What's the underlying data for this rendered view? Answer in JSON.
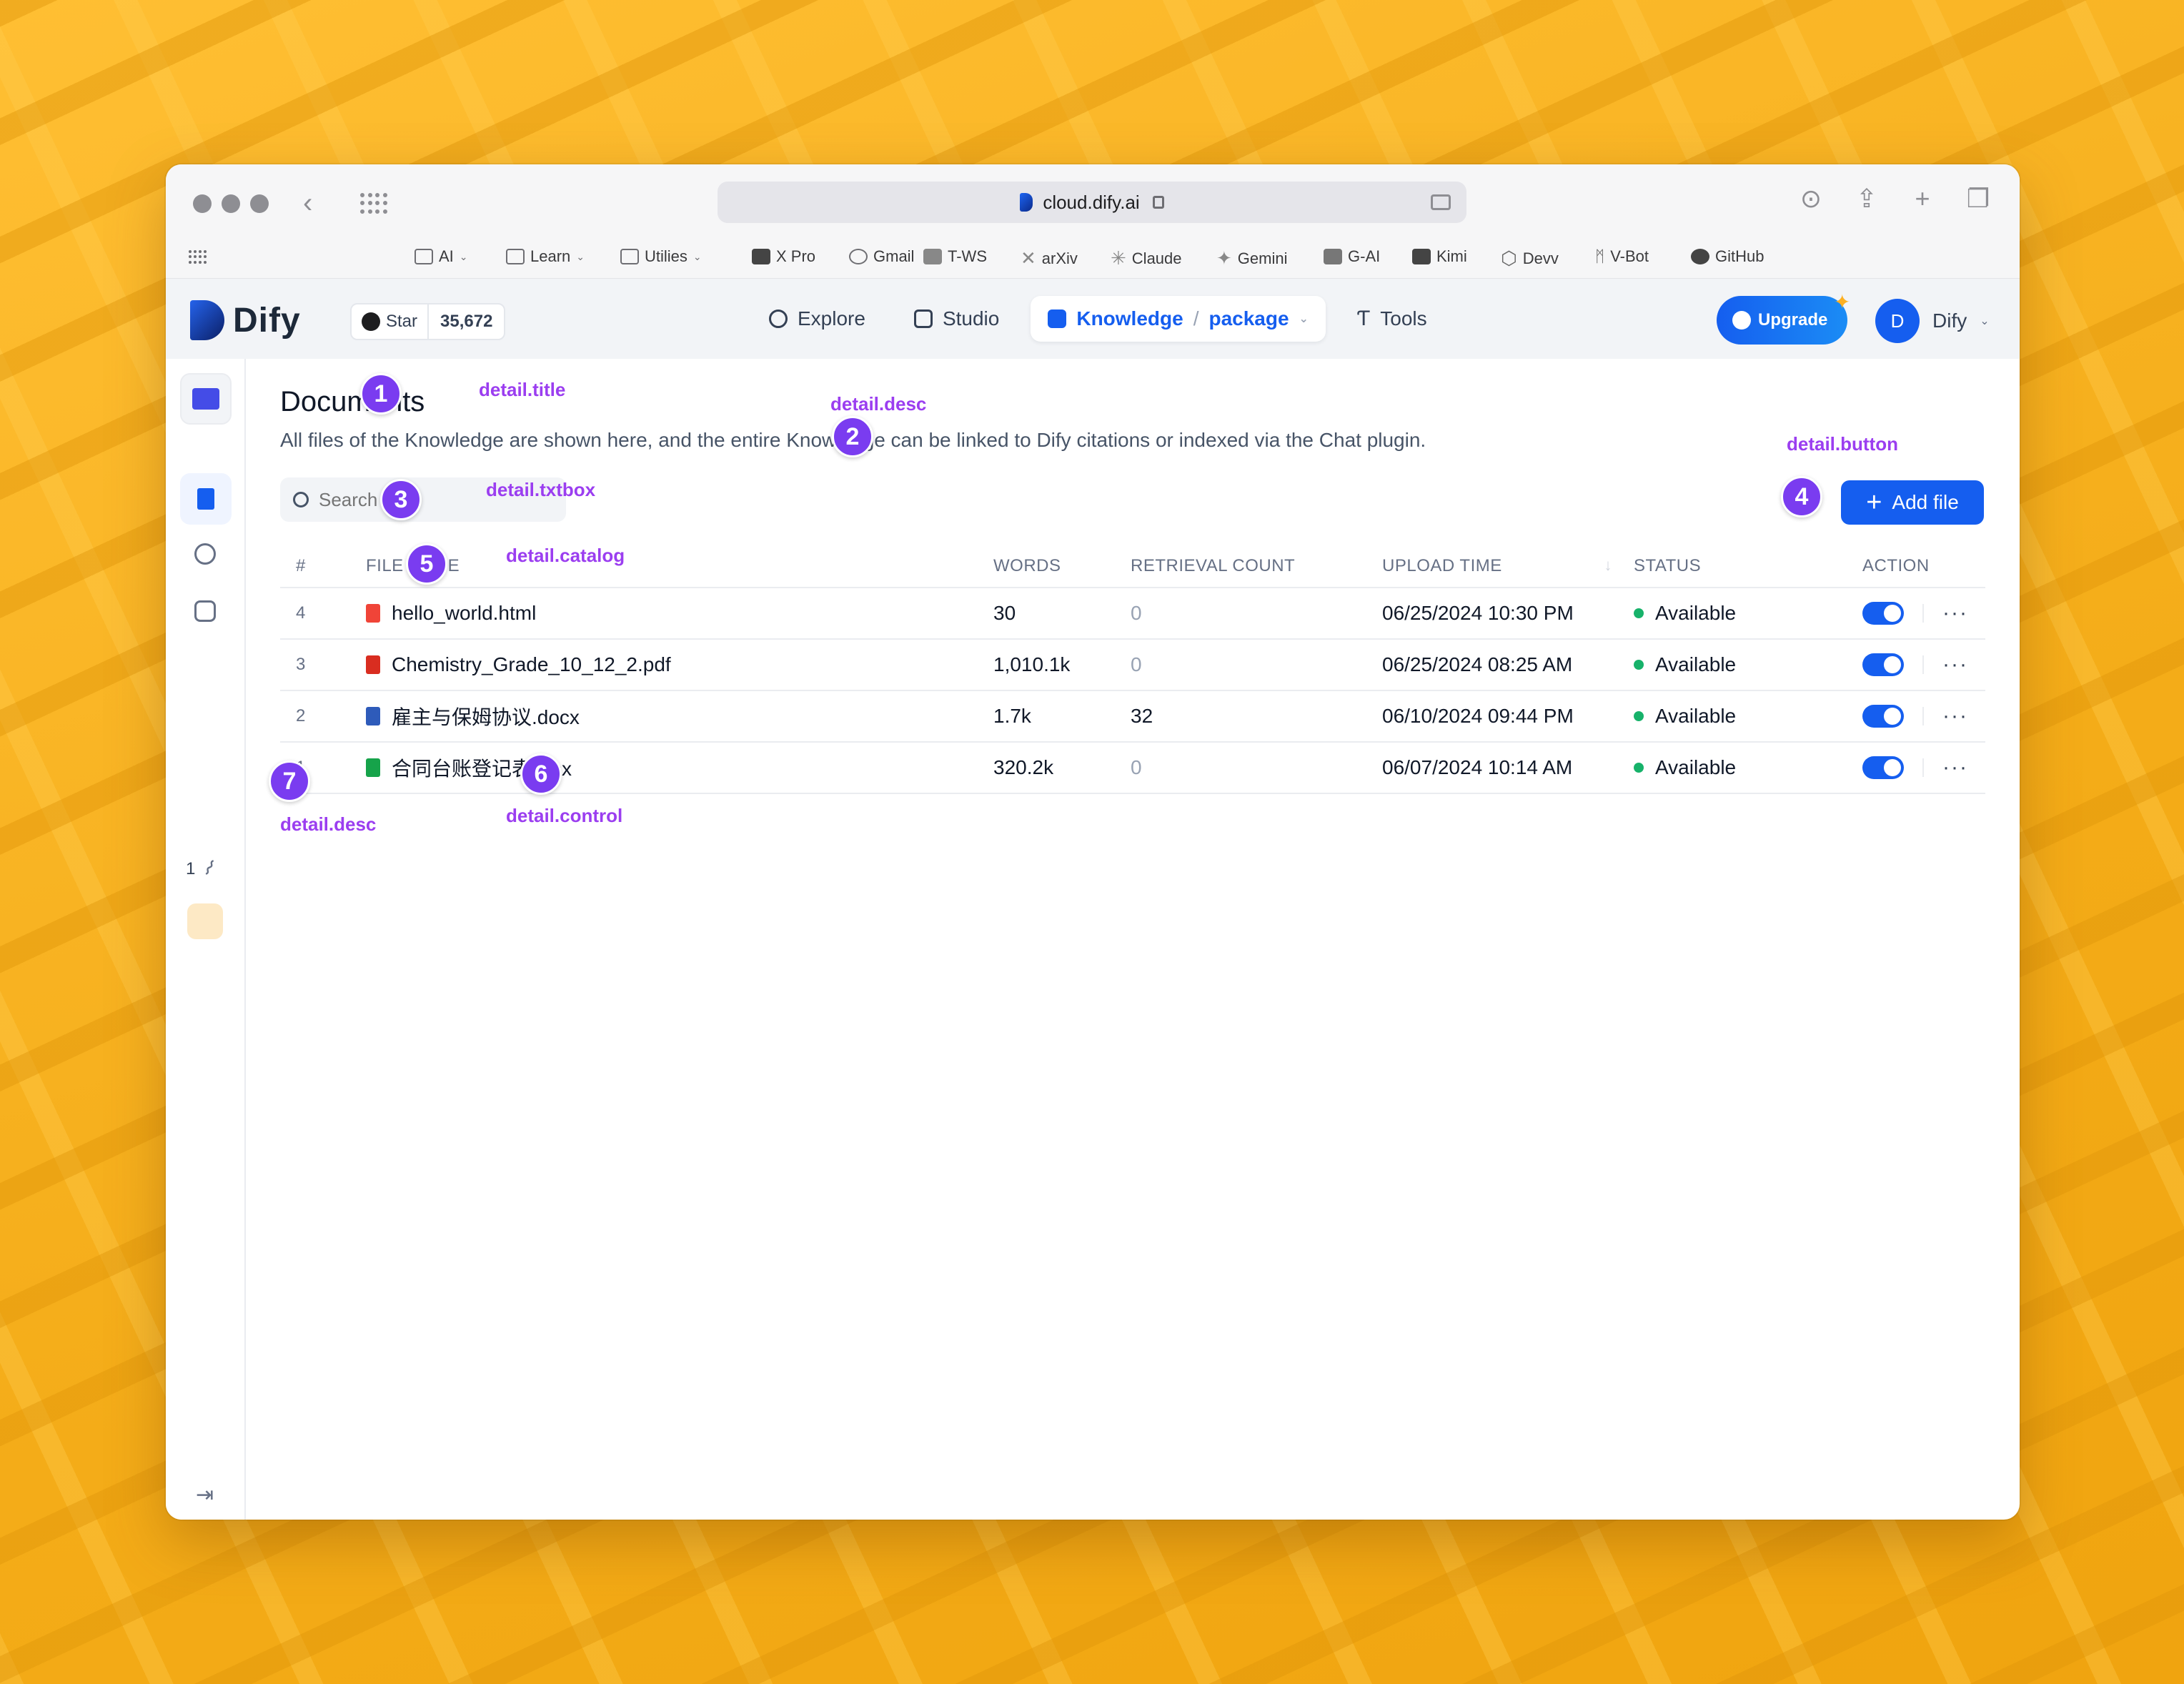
{
  "browser": {
    "url": "cloud.dify.ai",
    "bookmarks": [
      {
        "label": "AI",
        "dropdown": true
      },
      {
        "label": "Learn",
        "dropdown": true
      },
      {
        "label": "Utilies",
        "dropdown": true
      },
      {
        "label": "X Pro"
      },
      {
        "label": "Gmail"
      },
      {
        "label": "T-WS"
      },
      {
        "label": "arXiv"
      },
      {
        "label": "Claude"
      },
      {
        "label": "Gemini"
      },
      {
        "label": "G-AI"
      },
      {
        "label": "Kimi"
      },
      {
        "label": "Devv"
      },
      {
        "label": "V-Bot"
      },
      {
        "label": "GitHub"
      }
    ]
  },
  "header": {
    "logo": "Dify",
    "star_label": "Star",
    "star_count": "35,672",
    "nav": {
      "explore": "Explore",
      "studio": "Studio",
      "knowledge": "Knowledge",
      "separator": "/",
      "dataset": "package",
      "tools": "Tools"
    },
    "upgrade": "Upgrade",
    "user_initial": "D",
    "user_name": "Dify"
  },
  "rail": {
    "doc_count": "1"
  },
  "main": {
    "title": "Documents",
    "description": "All files of the Knowledge are shown here, and the entire Knowledge can be linked to Dify citations or indexed via the Chat plugin.",
    "search_placeholder": "Search",
    "add_button": "Add file",
    "columns": {
      "index": "#",
      "file_name": "FILE NAME",
      "words": "WORDS",
      "retrieval": "RETRIEVAL COUNT",
      "upload_time": "UPLOAD TIME",
      "status": "STATUS",
      "action": "ACTION"
    },
    "rows": [
      {
        "index": "4",
        "name": "hello_world.html",
        "icon_color": "#f04438",
        "words": "30",
        "retrieval": "0",
        "upload_time": "06/25/2024 10:30 PM",
        "status": "Available"
      },
      {
        "index": "3",
        "name": "Chemistry_Grade_10_12_2.pdf",
        "icon_color": "#d92d20",
        "words": "1,010.1k",
        "retrieval": "0",
        "upload_time": "06/25/2024 08:25 AM",
        "status": "Available"
      },
      {
        "index": "2",
        "name": "雇主与保姆协议.docx",
        "icon_color": "#2e5bba",
        "words": "1.7k",
        "retrieval": "32",
        "upload_time": "06/10/2024 09:44 PM",
        "status": "Available"
      },
      {
        "index": "1",
        "name": "合同台账登记表.xlsx",
        "icon_color": "#16a34a",
        "words": "320.2k",
        "retrieval": "0",
        "upload_time": "06/07/2024 10:14 AM",
        "status": "Available"
      }
    ]
  },
  "annotations": {
    "b1": "1",
    "b2": "2",
    "b3": "3",
    "b4": "4",
    "b5": "5",
    "b6": "6",
    "b7": "7",
    "title": "detail.title",
    "desc": "detail.desc",
    "button": "detail.button",
    "txtbox": "detail.txtbox",
    "catalog": "detail.catalog",
    "control": "detail.control",
    "desc2": "detail.desc"
  },
  "colors": {
    "accent": "#155eef",
    "status_available": "#17b26a",
    "annotation": "#7a3cf0",
    "background": "#f7b21f"
  }
}
